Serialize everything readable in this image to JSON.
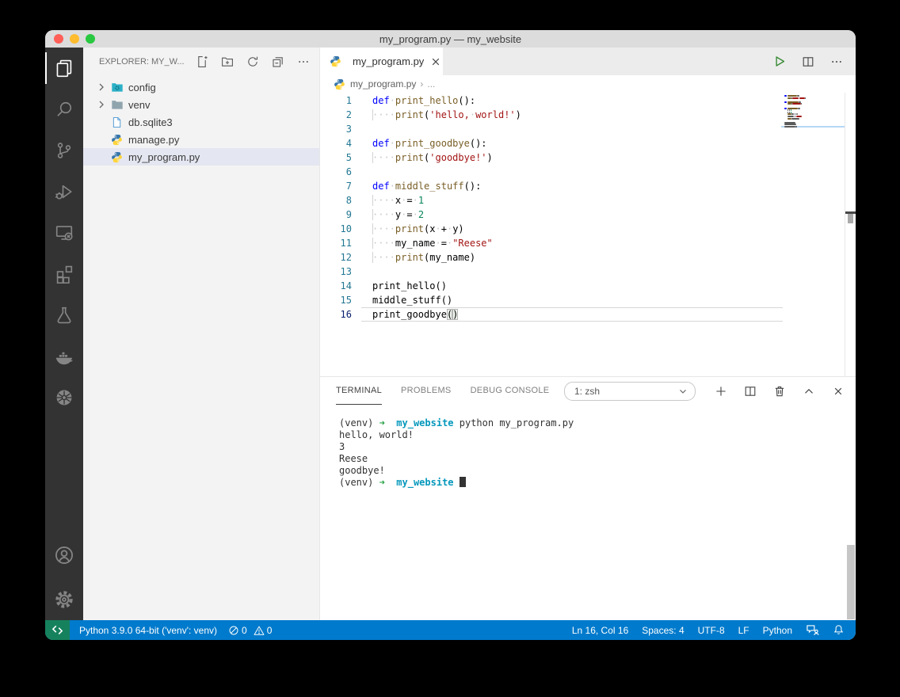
{
  "window": {
    "title": "my_program.py — my_website"
  },
  "colors": {
    "keyword": "#0000ff",
    "function": "#795E26",
    "string": "#a31515",
    "number": "#098658",
    "plain": "#000000",
    "whitespace": "#c8c8c8",
    "terminal_green": "#27a344",
    "terminal_cyan": "#0598bc",
    "statusbar": "#007acc",
    "remote_indicator": "#16825d",
    "run_button": "#388a34"
  },
  "activity_bar": {
    "items": [
      {
        "name": "explorer",
        "icon": "files-icon",
        "active": true
      },
      {
        "name": "search",
        "icon": "search-icon"
      },
      {
        "name": "source-control",
        "icon": "source-control-icon"
      },
      {
        "name": "run-and-debug",
        "icon": "debug-icon"
      },
      {
        "name": "remote-explorer",
        "icon": "remote-explorer-icon"
      },
      {
        "name": "extensions",
        "icon": "extensions-icon"
      },
      {
        "name": "testing",
        "icon": "beaker-icon"
      },
      {
        "name": "docker",
        "icon": "docker-icon"
      },
      {
        "name": "kubernetes",
        "icon": "kubernetes-icon"
      }
    ],
    "bottom_items": [
      {
        "name": "accounts",
        "icon": "account-icon"
      },
      {
        "name": "settings",
        "icon": "gear-icon"
      }
    ]
  },
  "sidebar": {
    "header": "EXPLORER: MY_W...",
    "actions": [
      "new-file-icon",
      "new-folder-icon",
      "refresh-icon",
      "collapse-all-icon",
      "more-icon"
    ],
    "tree": [
      {
        "label": "config",
        "icon": "folder-config",
        "chevron": true
      },
      {
        "label": "venv",
        "icon": "folder",
        "chevron": true
      },
      {
        "label": "db.sqlite3",
        "icon": "database-file"
      },
      {
        "label": "manage.py",
        "icon": "python"
      },
      {
        "label": "my_program.py",
        "icon": "python",
        "selected": true
      }
    ]
  },
  "editor": {
    "tab": {
      "label": "my_program.py"
    },
    "breadcrumb": {
      "file": "my_program.py",
      "separator": "›",
      "more": "..."
    },
    "current_line": 16,
    "code": [
      [
        [
          "kw",
          "def"
        ],
        [
          "ws",
          " "
        ],
        [
          "fn",
          "print_hello"
        ],
        [
          "pl",
          "():"
        ]
      ],
      [
        [
          "ind",
          "    "
        ],
        [
          "fn",
          "print"
        ],
        [
          "pl",
          "("
        ],
        [
          "str",
          "'hello,"
        ],
        [
          "ws",
          " "
        ],
        [
          "str",
          "world!'"
        ],
        [
          "pl",
          ")"
        ]
      ],
      [],
      [
        [
          "kw",
          "def"
        ],
        [
          "ws",
          " "
        ],
        [
          "fn",
          "print_goodbye"
        ],
        [
          "pl",
          "():"
        ]
      ],
      [
        [
          "ind",
          "    "
        ],
        [
          "fn",
          "print"
        ],
        [
          "pl",
          "("
        ],
        [
          "str",
          "'goodbye!'"
        ],
        [
          "pl",
          ")"
        ]
      ],
      [],
      [
        [
          "kw",
          "def"
        ],
        [
          "ws",
          " "
        ],
        [
          "fn",
          "middle_stuff"
        ],
        [
          "pl",
          "():"
        ]
      ],
      [
        [
          "ind",
          "    "
        ],
        [
          "pl",
          "x"
        ],
        [
          "ws",
          " "
        ],
        [
          "pl",
          "="
        ],
        [
          "ws",
          " "
        ],
        [
          "num",
          "1"
        ]
      ],
      [
        [
          "ind",
          "    "
        ],
        [
          "pl",
          "y"
        ],
        [
          "ws",
          " "
        ],
        [
          "pl",
          "="
        ],
        [
          "ws",
          " "
        ],
        [
          "num",
          "2"
        ]
      ],
      [
        [
          "ind",
          "    "
        ],
        [
          "fn",
          "print"
        ],
        [
          "pl",
          "(x"
        ],
        [
          "ws",
          " "
        ],
        [
          "pl",
          "+"
        ],
        [
          "ws",
          " "
        ],
        [
          "pl",
          "y)"
        ]
      ],
      [
        [
          "ind",
          "    "
        ],
        [
          "pl",
          "my_name"
        ],
        [
          "ws",
          " "
        ],
        [
          "pl",
          "="
        ],
        [
          "ws",
          " "
        ],
        [
          "str",
          "\"Reese\""
        ]
      ],
      [
        [
          "ind",
          "    "
        ],
        [
          "fn",
          "print"
        ],
        [
          "pl",
          "(my_name)"
        ]
      ],
      [],
      [
        [
          "pl",
          "print_hello()"
        ]
      ],
      [
        [
          "pl",
          "middle_stuff()"
        ]
      ],
      [
        [
          "pl",
          "print_goodbye"
        ],
        [
          "bm",
          "("
        ],
        [
          "bm",
          ")"
        ]
      ]
    ]
  },
  "panel": {
    "tabs": [
      {
        "label": "TERMINAL",
        "active": true
      },
      {
        "label": "PROBLEMS"
      },
      {
        "label": "DEBUG CONSOLE"
      }
    ],
    "shell_selector": "1: zsh",
    "actions": [
      "plus-icon",
      "split-terminal-icon",
      "trash-icon",
      "chevron-up-icon",
      "close-icon"
    ]
  },
  "terminal_lines": [
    [
      [
        "p",
        "(venv) "
      ],
      [
        "g",
        "➜"
      ],
      [
        "p",
        "  "
      ],
      [
        "c",
        "my_website"
      ],
      [
        "p",
        " python my_program.py"
      ]
    ],
    [
      [
        "p",
        "hello, world!"
      ]
    ],
    [
      [
        "p",
        "3"
      ]
    ],
    [
      [
        "p",
        "Reese"
      ]
    ],
    [
      [
        "p",
        "goodbye!"
      ]
    ],
    [
      [
        "p",
        "(venv) "
      ],
      [
        "g",
        "➜"
      ],
      [
        "p",
        "  "
      ],
      [
        "c",
        "my_website"
      ],
      [
        "p",
        " "
      ],
      [
        "cur",
        ""
      ]
    ]
  ],
  "status_bar": {
    "python_interpreter": "Python 3.9.0 64-bit ('venv': venv)",
    "errors": "0",
    "warnings": "0",
    "right_items": [
      {
        "name": "line-col",
        "label": "Ln 16, Col 16"
      },
      {
        "name": "indentation",
        "label": "Spaces: 4"
      },
      {
        "name": "encoding",
        "label": "UTF-8"
      },
      {
        "name": "eol",
        "label": "LF"
      },
      {
        "name": "language-mode",
        "label": "Python"
      }
    ]
  }
}
